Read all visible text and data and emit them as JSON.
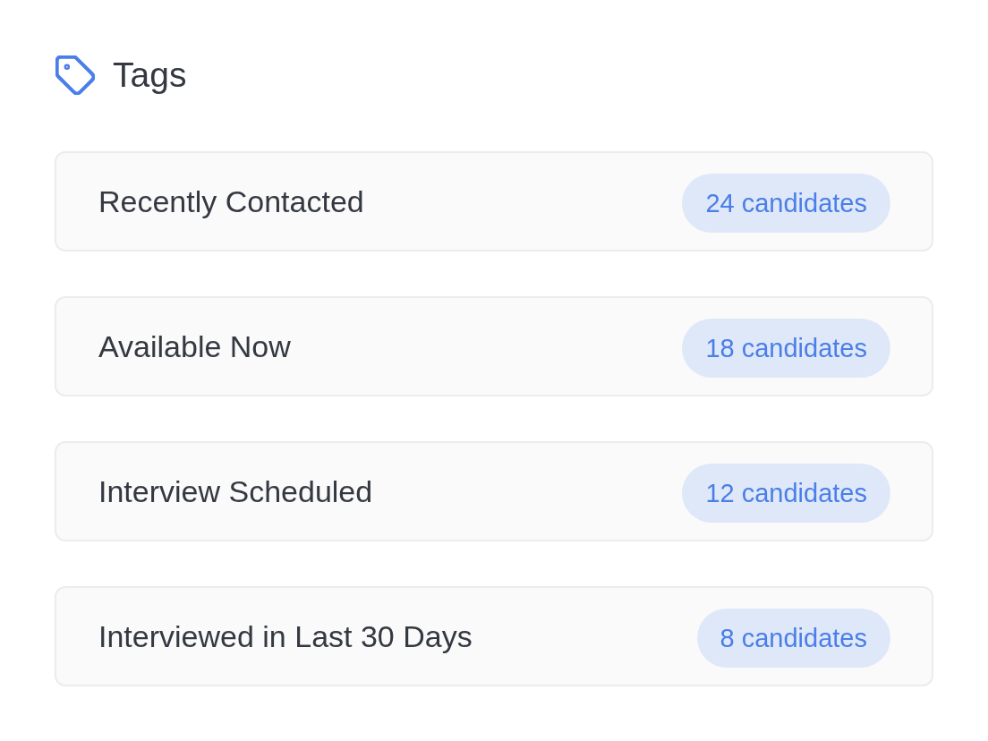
{
  "header": {
    "title": "Tags"
  },
  "tags": [
    {
      "name": "Recently Contacted",
      "count": "24 candidates"
    },
    {
      "name": "Available Now",
      "count": "18 candidates"
    },
    {
      "name": "Interview Scheduled",
      "count": "12 candidates"
    },
    {
      "name": "Interviewed in Last 30 Days",
      "count": "8 candidates"
    }
  ]
}
